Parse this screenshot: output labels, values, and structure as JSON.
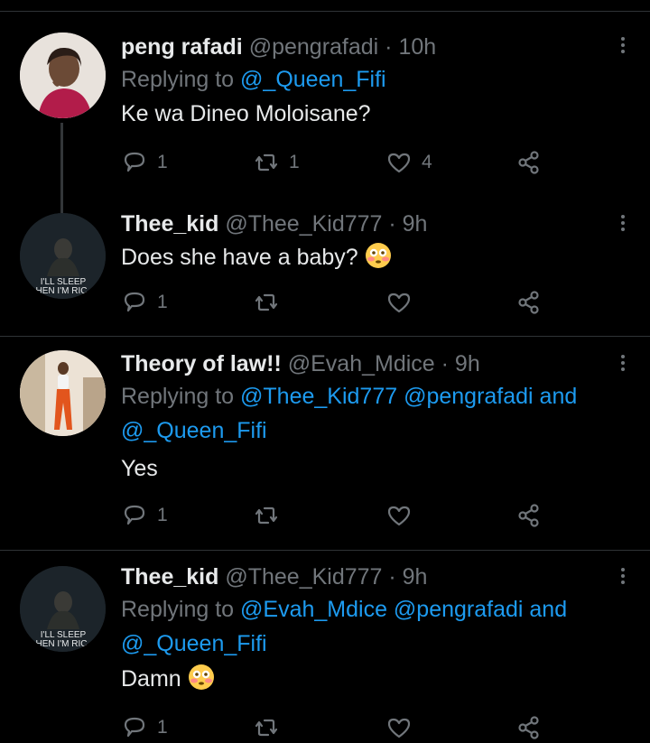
{
  "tweets": [
    {
      "name": "peng rafadi",
      "handle": "@pengrafadi",
      "time": "10h",
      "replying_prefix": "Replying to ",
      "replying_line1": "@_Queen_Fifi",
      "replying_line2": "",
      "text": "Ke wa Dineo Moloisane?",
      "reply_count": "1",
      "retweet_count": "1",
      "like_count": "4"
    },
    {
      "name": "Thee_kid",
      "handle": "@Thee_Kid777",
      "time": "9h",
      "text": "Does she have a baby?",
      "reply_count": "1",
      "retweet_count": "",
      "like_count": "",
      "avatar_text_1": "I'LL SLEEP",
      "avatar_text_2": "HEN I'M RIC"
    },
    {
      "name": "Theory of law!!",
      "handle": "@Evah_Mdice",
      "time": "9h",
      "replying_prefix": "Replying to ",
      "replying_line1": "@Thee_Kid777 @pengrafadi and",
      "replying_line2": "@_Queen_Fifi",
      "text": "Yes",
      "reply_count": "1",
      "retweet_count": "",
      "like_count": ""
    },
    {
      "name": "Thee_kid",
      "handle": "@Thee_Kid777",
      "time": "9h",
      "replying_prefix": "Replying to ",
      "replying_line1": "@Evah_Mdice @pengrafadi and",
      "replying_line2": "@_Queen_Fifi",
      "text": "Damn",
      "reply_count": "1",
      "retweet_count": "",
      "like_count": "",
      "avatar_text_1": "I'LL SLEEP",
      "avatar_text_2": "HEN I'M RIC"
    }
  ],
  "separator": " · ",
  "icons": {
    "reply": "reply-icon",
    "retweet": "retweet-icon",
    "like": "heart-icon",
    "share": "share-icon",
    "more": "more-icon",
    "emoji": "flushed-face-emoji"
  },
  "colors": {
    "background": "#000000",
    "text": "#e7e9ea",
    "muted": "#71767b",
    "link": "#1d9bf0"
  }
}
